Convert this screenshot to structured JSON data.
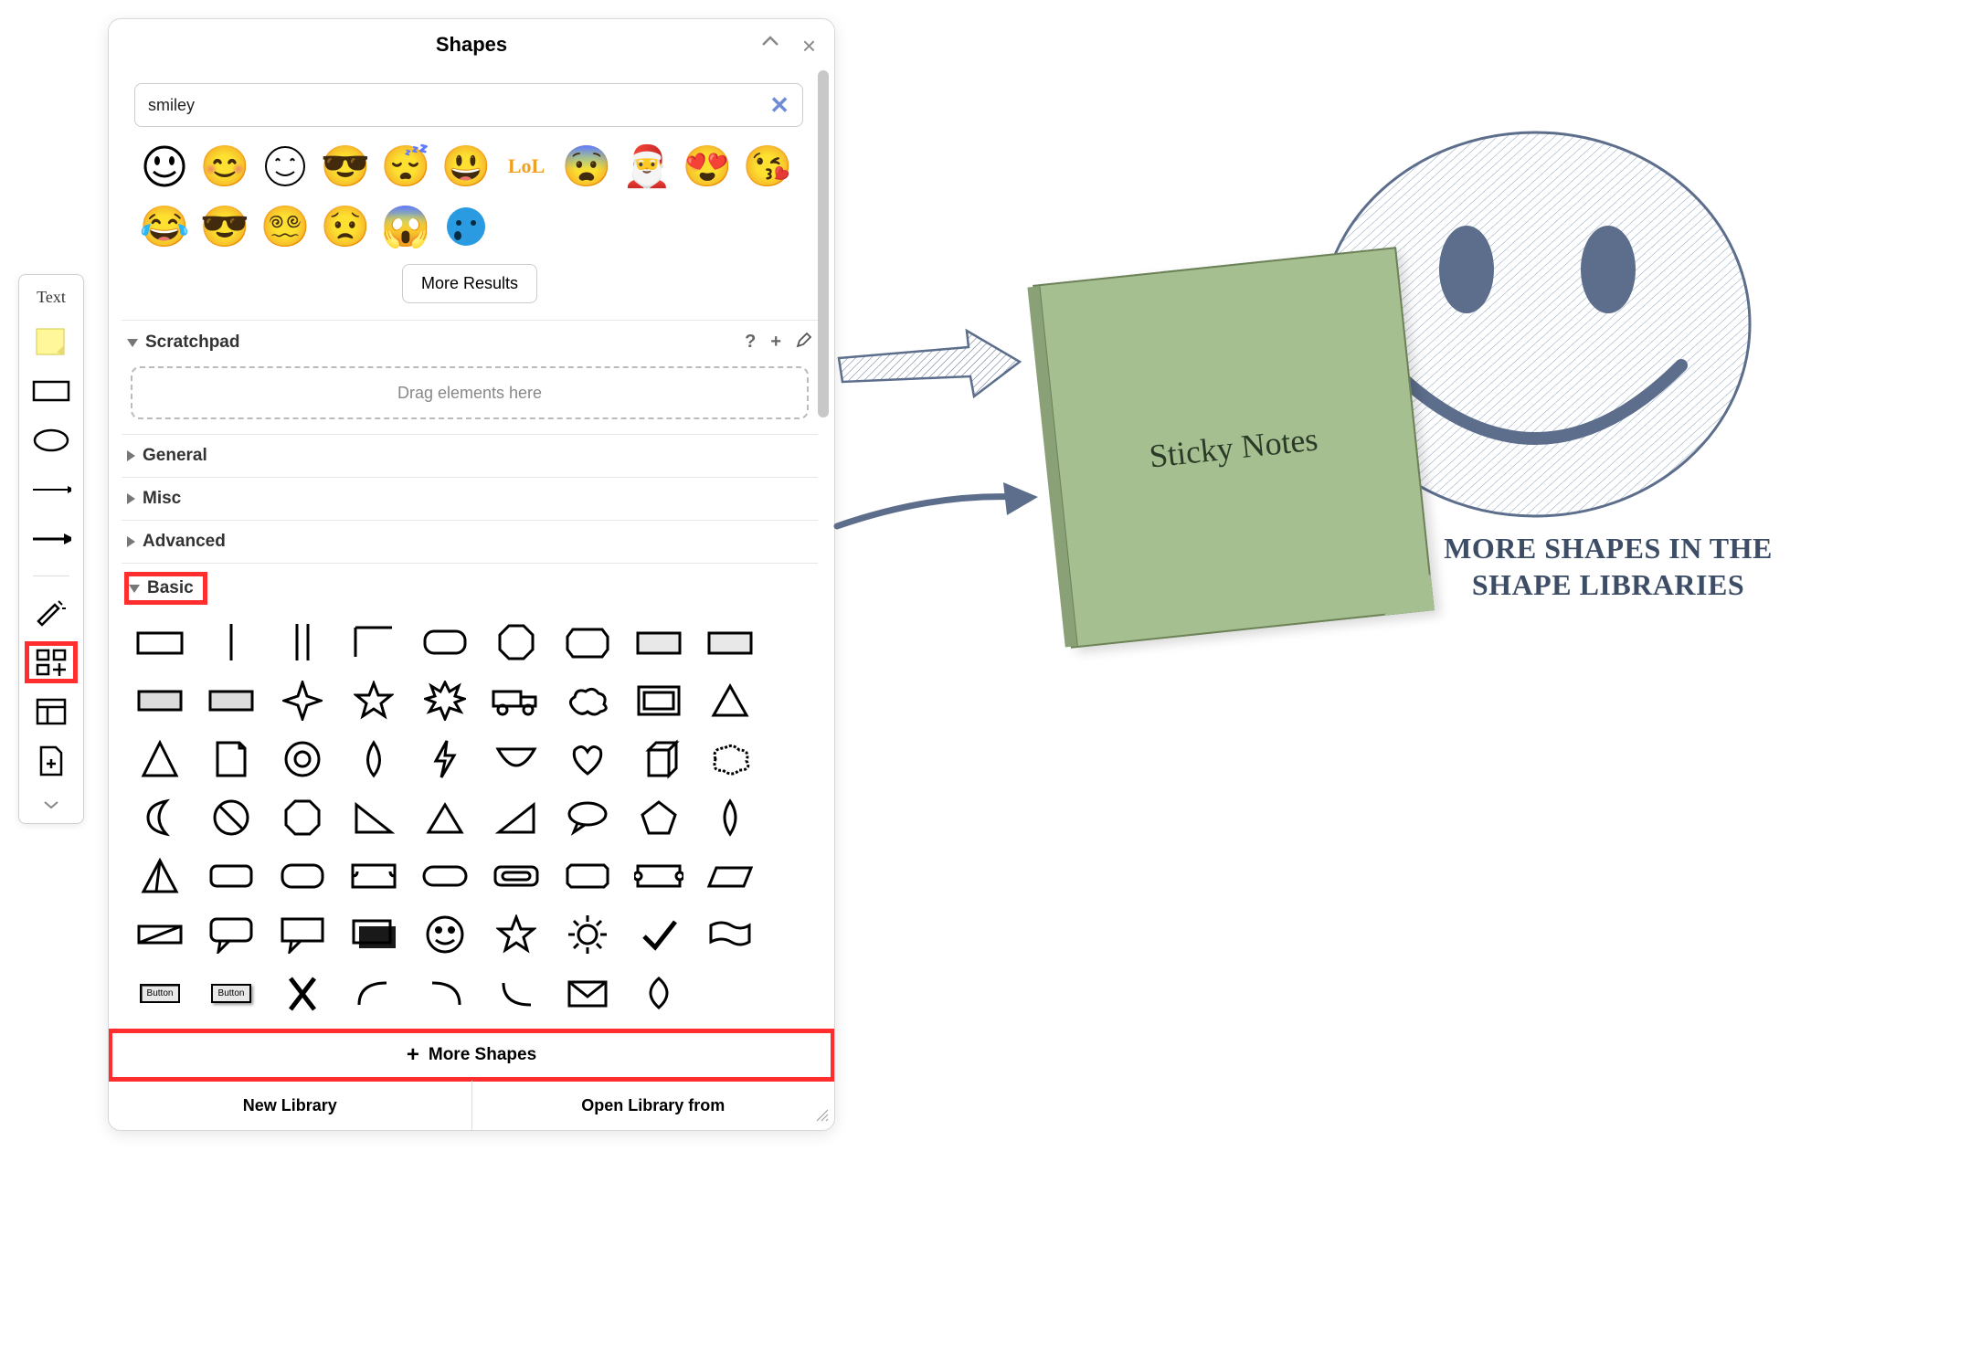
{
  "leftToolbar": {
    "textLabel": "Text"
  },
  "panel": {
    "title": "Shapes",
    "search": {
      "value": "smiley"
    },
    "moreResults": "More Results",
    "sections": {
      "scratchpad": {
        "label": "Scratchpad",
        "dropHint": "Drag elements here",
        "help": "?",
        "add": "+",
        "edit": "✎"
      },
      "general": {
        "label": "General"
      },
      "misc": {
        "label": "Misc"
      },
      "advanced": {
        "label": "Advanced"
      },
      "basic": {
        "label": "Basic"
      }
    },
    "emojis": [
      "😀",
      "😊",
      "☺",
      "😎",
      "😴",
      "😃",
      "LoL",
      "😨",
      "🎅",
      "😍",
      "😘",
      "😂",
      "😎",
      "😵",
      "😟",
      "😱",
      "🔵"
    ],
    "basicShapeButtons": [
      "Button",
      "Button"
    ],
    "moreShapes": "More Shapes",
    "newLibrary": "New Library",
    "openLibrary": "Open Library from"
  },
  "canvas": {
    "stickyText": "Sticky Notes",
    "caption": "More shapes in the shape libraries"
  }
}
